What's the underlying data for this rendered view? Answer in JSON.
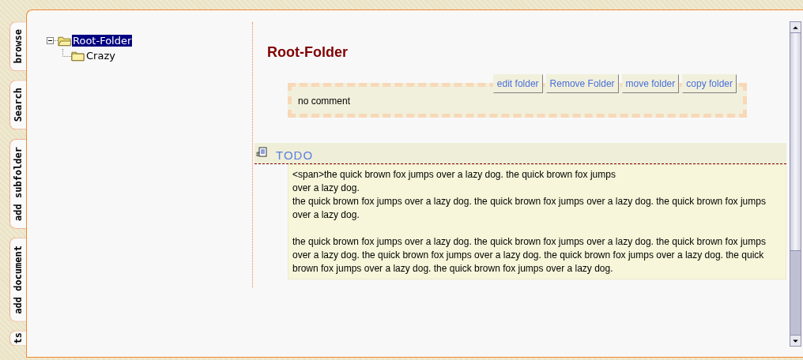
{
  "tabs": [
    {
      "label": "browse"
    },
    {
      "label": "Search"
    },
    {
      "label": "add subfolder"
    },
    {
      "label": "add document"
    },
    {
      "label": "ts"
    }
  ],
  "tree": [
    {
      "label": "Root-Folder",
      "selected": true,
      "expanded": true,
      "children": [
        {
          "label": "Crazy",
          "selected": false
        }
      ]
    }
  ],
  "folder": {
    "title": "Root-Folder",
    "buttons": [
      "edit folder",
      "Remove Folder",
      "move folder",
      "copy folder"
    ],
    "comment": "no comment"
  },
  "todo": {
    "title": "TODO",
    "paragraphs": [
      [
        "<span>the quick brown fox jumps over a lazy dog. the quick brown fox jumps",
        "over a lazy dog.",
        "the quick brown fox jumps over a lazy dog. the quick brown fox jumps over a lazy dog. the quick brown fox jumps over a lazy dog."
      ],
      [
        "the quick brown fox jumps over a lazy dog. the quick brown fox jumps over a lazy dog. the quick brown fox jumps over a lazy dog. the quick brown fox jumps over a lazy dog. the quick brown fox jumps over a lazy dog. the quick brown fox jumps over a lazy dog. the quick brown fox jumps over a lazy dog."
      ]
    ]
  }
}
